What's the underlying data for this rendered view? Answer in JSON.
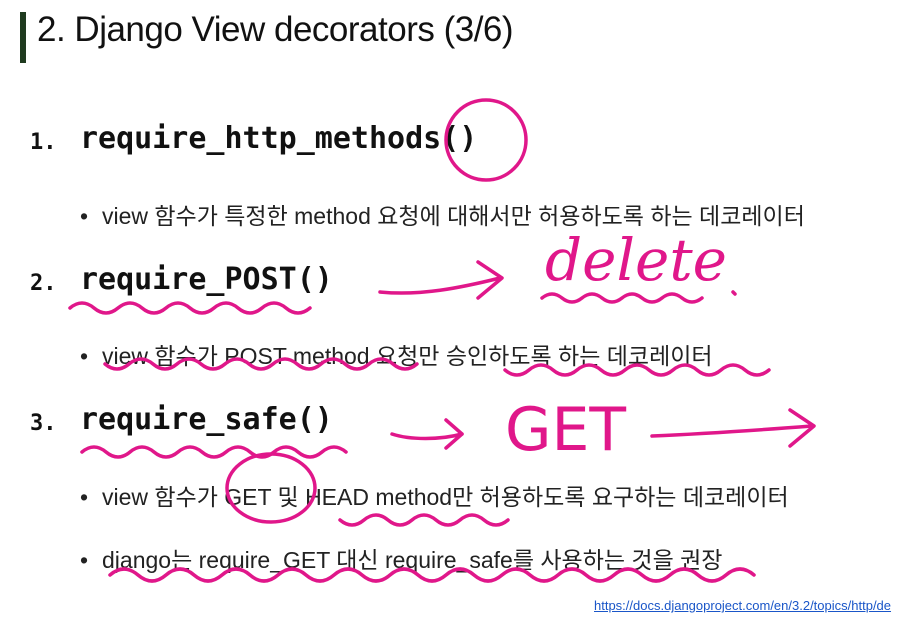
{
  "slide": {
    "title": "2. Django View decorators (3/6)",
    "items": [
      {
        "number": "1.",
        "code": "require_http_methods()",
        "bullets": [
          "view 함수가 특정한 method 요청에 대해서만 허용하도록 하는 데코레이터"
        ]
      },
      {
        "number": "2.",
        "code": "require_POST()",
        "bullets": [
          "view 함수가 POST method 요청만 승인하도록 하는 데코레이터"
        ]
      },
      {
        "number": "3.",
        "code": "require_safe()",
        "bullets": [
          "view 함수가 GET 및 HEAD method만 허용하도록 요구하는 데코레이터",
          "django는 require_GET 대신 require_safe를 사용하는 것을 권장"
        ]
      }
    ],
    "bullet_symbol": "•",
    "footer_link": "https://docs.djangoproject.com/en/3.2/topics/http/de"
  },
  "annotations": {
    "note_post": "delete",
    "note_safe": "GET",
    "ink_color": "#e0178a"
  }
}
